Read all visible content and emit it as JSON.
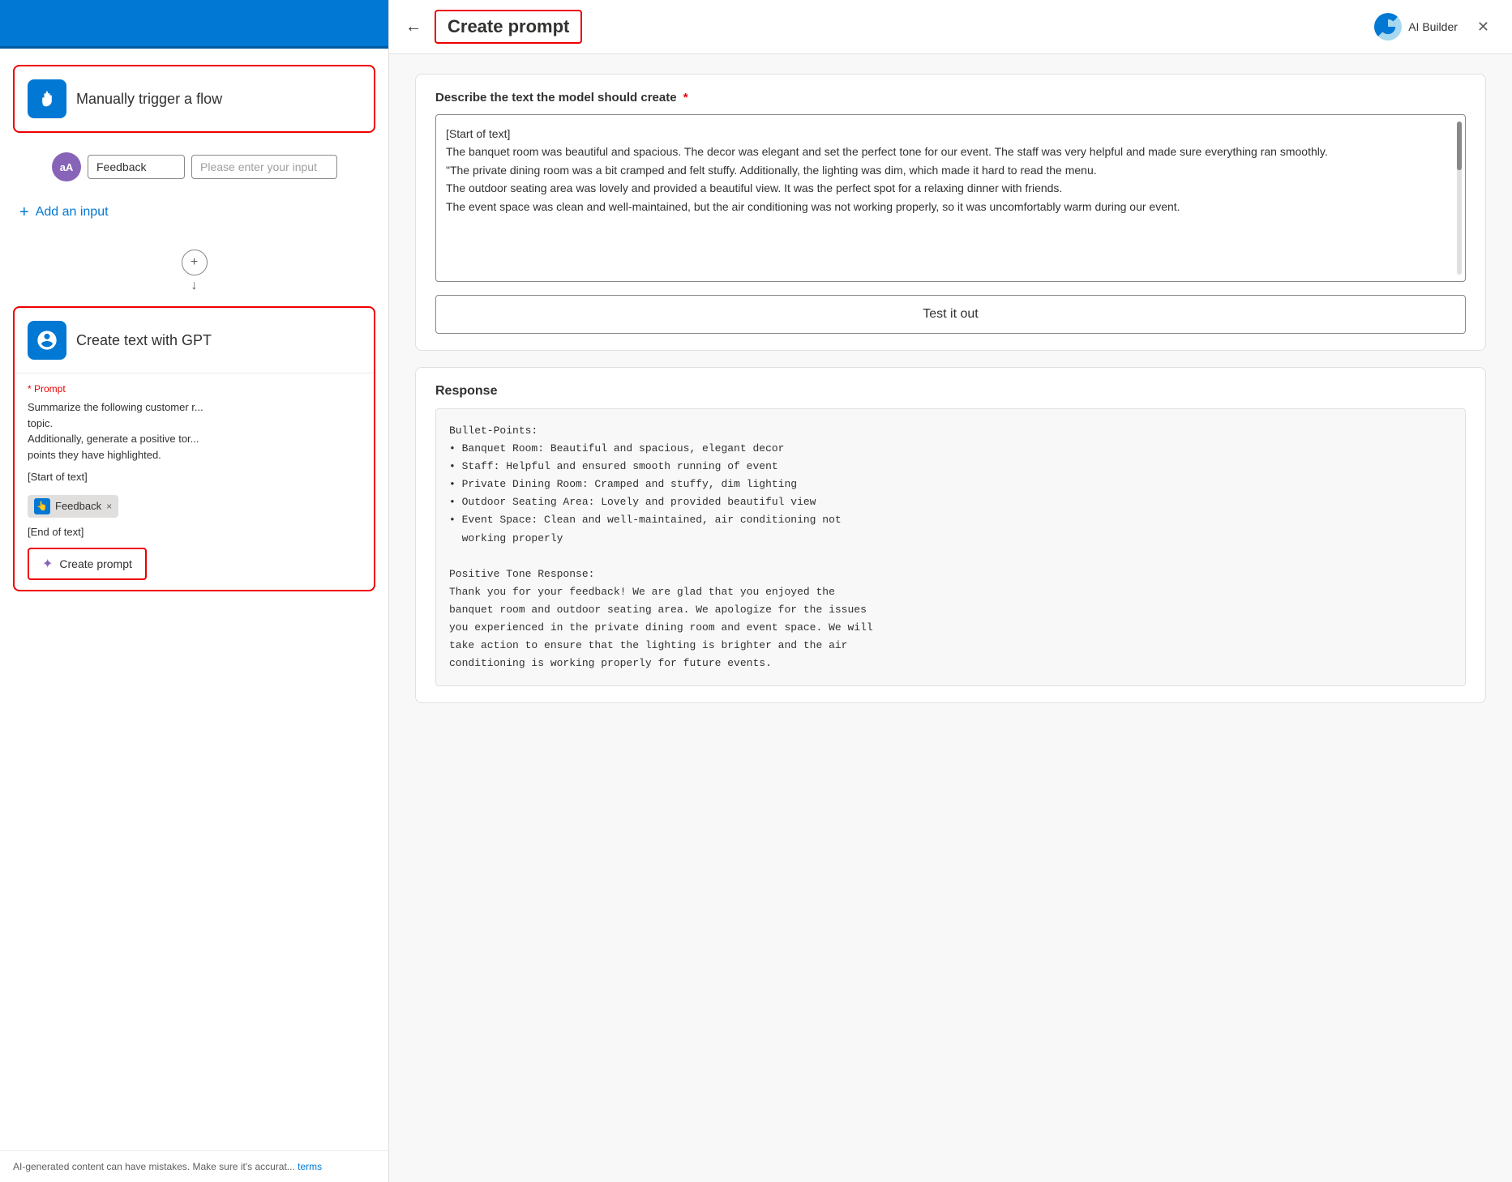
{
  "left": {
    "top_bar_color": "#0078d4",
    "trigger": {
      "label": "Manually trigger a flow",
      "icon": "👆"
    },
    "input_row": {
      "avatar_initials": "aA",
      "field_value": "Feedback",
      "placeholder": "Please enter your input"
    },
    "add_input": {
      "label": "Add an input"
    },
    "gpt_block": {
      "label": "Create text with GPT",
      "icon": "🧠",
      "prompt_label": "* Prompt",
      "prompt_lines": [
        "Summarize the following customer r...",
        "topic.",
        "Additionally, generate a positive tor...",
        "points they have highlighted."
      ],
      "start_text": "[Start of text]",
      "feedback_tag": "Feedback",
      "end_text": "[End of text]"
    },
    "create_prompt_btn": {
      "label": "Create prompt",
      "sparkle": "✦"
    },
    "footer": {
      "text": "AI-generated content can have mistakes. Make sure it's accurat...",
      "link_text": "terms"
    }
  },
  "right": {
    "back_icon": "←",
    "title": "Create prompt",
    "ai_builder_label": "AI Builder",
    "close_icon": "✕",
    "describe": {
      "label": "Describe the text the model should create",
      "required_marker": "*",
      "content": "[Start of text]\nThe banquet room was beautiful and spacious. The decor was elegant and set the perfect tone for our event. The staff was very helpful and made sure everything ran smoothly.\n\"The private dining room was a bit cramped and felt stuffy. Additionally, the lighting was dim, which made it hard to read the menu.\nThe outdoor seating area was lovely and provided a beautiful view. It was the perfect spot for a relaxing dinner with friends.\nThe event space was clean and well-maintained, but the air conditioning was not working properly, so it was uncomfortably warm during our event."
    },
    "test_btn": {
      "label": "Test it out"
    },
    "response": {
      "label": "Response",
      "content": "Bullet-Points:\n• Banquet Room: Beautiful and spacious, elegant decor\n• Staff: Helpful and ensured smooth running of event\n• Private Dining Room: Cramped and stuffy, dim lighting\n• Outdoor Seating Area: Lovely and provided beautiful view\n• Event Space: Clean and well-maintained, air conditioning not\n  working properly\n\nPositive Tone Response:\nThank you for your feedback! We are glad that you enjoyed the\nbanquet room and outdoor seating area. We apologize for the issues\nyou experienced in the private dining room and event space. We will\ntake action to ensure that the lighting is brighter and the air\nconditioning is working properly for future events."
    }
  }
}
